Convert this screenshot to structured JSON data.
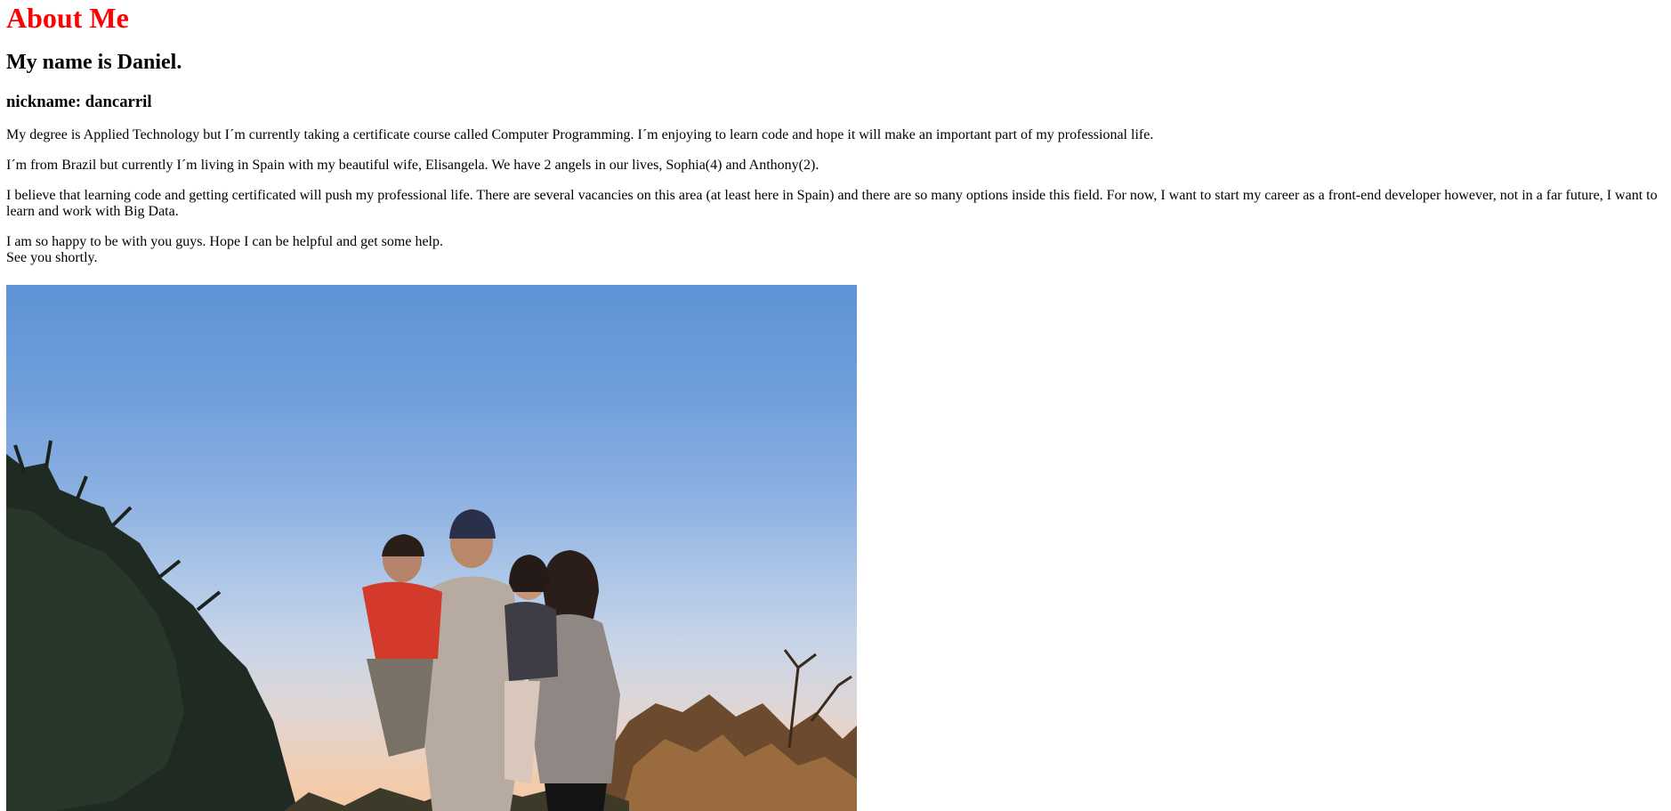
{
  "page": {
    "title": "About Me",
    "title_color": "#ff0000",
    "name_line": "My name is Daniel.",
    "nickname_line": "nickname: dancarril",
    "paragraphs": {
      "degree": "My degree is Applied Technology but I´m currently taking a certificate course called Computer Programming. I´m enjoying to learn code and hope it will make an important part of my professional life.",
      "origin": "I´m from Brazil but currently I´m living in Spain with my beautiful wife, Elisangela. We have 2 angels in our lives, Sophia(4) and Anthony(2).",
      "goals": "I believe that learning code and getting certificated will push my professional life. There are several vacancies on this area (at least here in Spain) and there are so many options inside this field. For now, I want to start my career as a front-end developer however, not in a far future, I want to learn and work with Big Data.",
      "closing_line1": "I am so happy to be with you guys. Hope I can be helpful and get some help.",
      "closing_line2": "See you shortly."
    }
  },
  "photo": {
    "subject": "family portrait outdoors at sunset with four people in front of trees"
  }
}
